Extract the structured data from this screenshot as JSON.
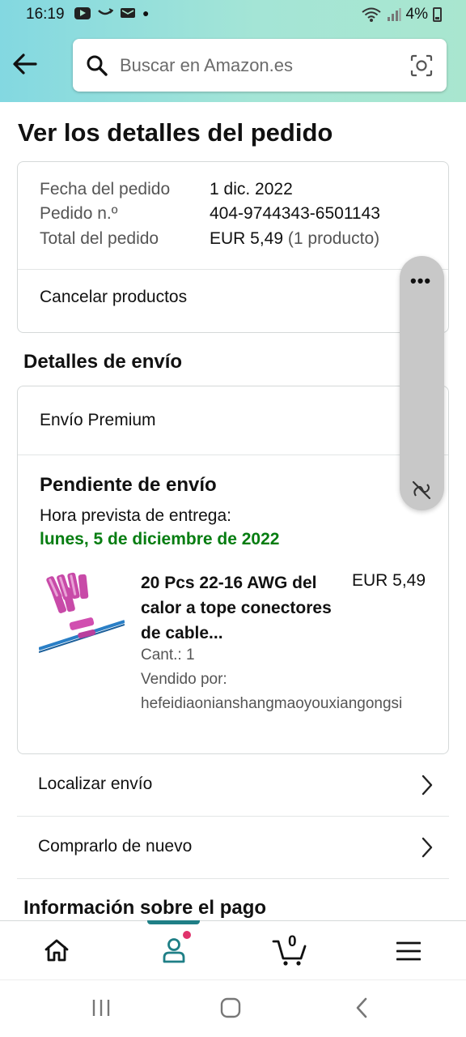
{
  "status_bar": {
    "time": "16:19",
    "battery": "4%"
  },
  "search": {
    "placeholder": "Buscar en Amazon.es"
  },
  "page_title": "Ver los detalles del pedido",
  "order": {
    "date_label": "Fecha del pedido",
    "date_value": "1 dic. 2022",
    "number_label": "Pedido n.º",
    "number_value": "404-9744343-6501143",
    "total_label": "Total del pedido",
    "total_value": "EUR 5,49",
    "total_count": "(1 producto)",
    "cancel_label": "Cancelar productos"
  },
  "shipping": {
    "section_title": "Detalles de envío",
    "method": "Envío Premium",
    "status": "Pendiente de envío",
    "eta_label": "Hora prevista de entrega:",
    "eta_date": "lunes, 5 de diciembre de 2022",
    "product": {
      "title": "20 Pcs 22-16 AWG del calor a tope conectores de cable...",
      "price": "EUR 5,49",
      "qty": "Cant.: 1",
      "sold_by_label": "Vendido por:",
      "seller": "hefeidiaonianshangmaoyouxiangongsi"
    }
  },
  "actions": {
    "track": "Localizar envío",
    "buy_again": "Comprarlo de nuevo"
  },
  "payment_title": "Información sobre el pago",
  "bottom_nav": {
    "cart_count": "0",
    "active": "account"
  },
  "colors": {
    "header_gradient_start": "#83d8e1",
    "header_gradient_end": "#a9e6cf",
    "delivery_green": "#067d11",
    "nav_indicator": "#1f7f86",
    "notification_dot": "#e0336c"
  }
}
